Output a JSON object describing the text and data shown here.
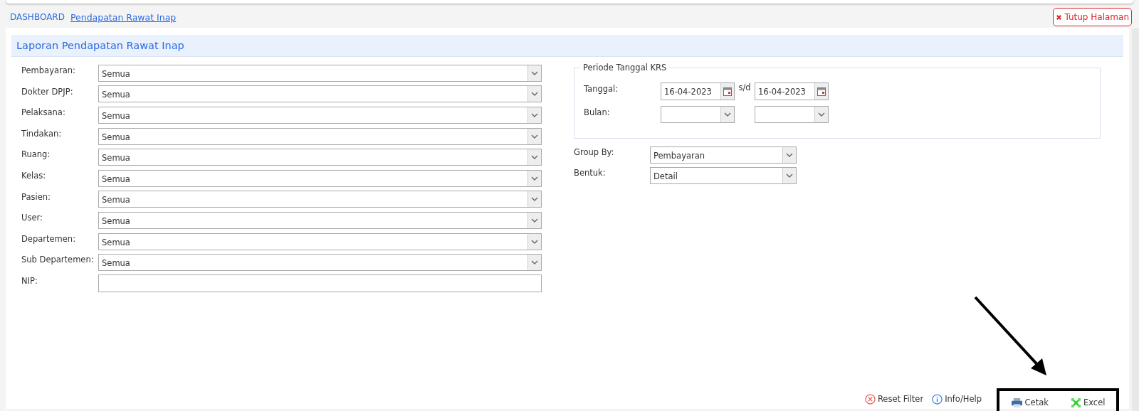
{
  "breadcrumb": [
    {
      "label": "DASHBOARD",
      "current": false
    },
    {
      "label": "Pendapatan Rawat Inap",
      "current": true
    }
  ],
  "close_button": {
    "label": "Tutup Halaman"
  },
  "panel": {
    "title": "Laporan Pendapatan Rawat Inap"
  },
  "filters": [
    {
      "label": "Pembayaran:",
      "kind": "select",
      "value": "Semua"
    },
    {
      "label": "Dokter DPJP:",
      "kind": "select",
      "value": "Semua"
    },
    {
      "label": "Pelaksana:",
      "kind": "select",
      "value": "Semua"
    },
    {
      "label": "Tindakan:",
      "kind": "select",
      "value": "Semua"
    },
    {
      "label": "Ruang:",
      "kind": "select",
      "value": "Semua"
    },
    {
      "label": "Kelas:",
      "kind": "select",
      "value": "Semua"
    },
    {
      "label": "Pasien:",
      "kind": "select",
      "value": "Semua"
    },
    {
      "label": "User:",
      "kind": "select",
      "value": "Semua"
    },
    {
      "label": "Departemen:",
      "kind": "select",
      "value": "Semua"
    },
    {
      "label": "Sub Departemen:",
      "kind": "select",
      "value": "Semua"
    },
    {
      "label": "NIP:",
      "kind": "text"
    }
  ],
  "period": {
    "legend": "Periode Tanggal KRS",
    "date_label": "Tanggal:",
    "date_from": "16-04-2023",
    "separator": "s/d",
    "date_to": "16-04-2023",
    "month_label": "Bulan:"
  },
  "options": [
    {
      "label": "Group By:",
      "value": "Pembayaran"
    },
    {
      "label": "Bentuk:",
      "value": "Detail"
    }
  ],
  "actions": [
    {
      "label": "Reset Filter",
      "kind": "reset",
      "highlighted": false
    },
    {
      "label": "Info/Help",
      "kind": "info",
      "highlighted": false
    },
    {
      "label": "Cetak",
      "kind": "print",
      "highlighted": true
    },
    {
      "label": "Excel",
      "kind": "excel",
      "highlighted": true
    }
  ]
}
